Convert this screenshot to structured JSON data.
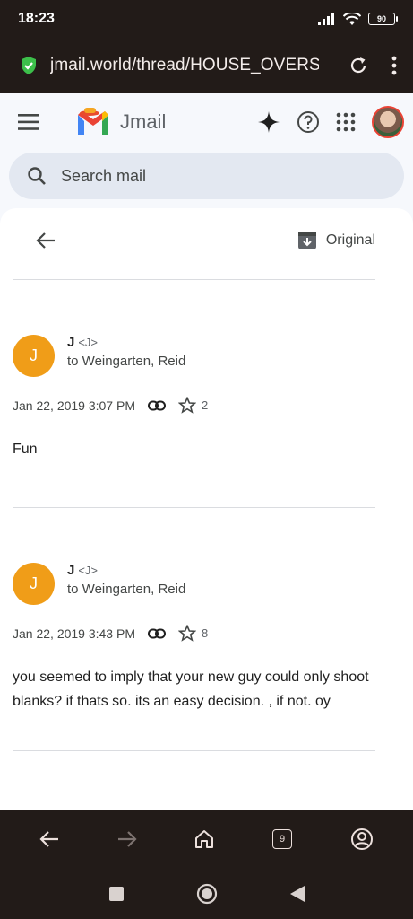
{
  "status": {
    "time": "18:23",
    "battery": "90"
  },
  "browser": {
    "url": "jmail.world/thread/HOUSE_OVERS"
  },
  "app": {
    "name": "Jmail",
    "search_placeholder": "Search mail",
    "original_label": "Original"
  },
  "messages": [
    {
      "avatar_letter": "J",
      "from_name": "J",
      "from_email": "<J>",
      "to": "to Weingarten, Reid",
      "date": "Jan 22, 2019 3:07 PM",
      "star_count": "2",
      "body": "Fun"
    },
    {
      "avatar_letter": "J",
      "from_name": "J",
      "from_email": "<J>",
      "to": "to Weingarten, Reid",
      "date": "Jan 22, 2019 3:43 PM",
      "star_count": "8",
      "body": "you seemed to imply that your new guy could only shoot blanks? if thats so. its an easy decision. , if not. oy"
    }
  ],
  "nav": {
    "tab_count": "9"
  },
  "colors": {
    "chrome": "#221b18",
    "avatar": "#f09d18",
    "app_bg": "#f6f8fc",
    "search_bg": "#e3e8f1"
  }
}
